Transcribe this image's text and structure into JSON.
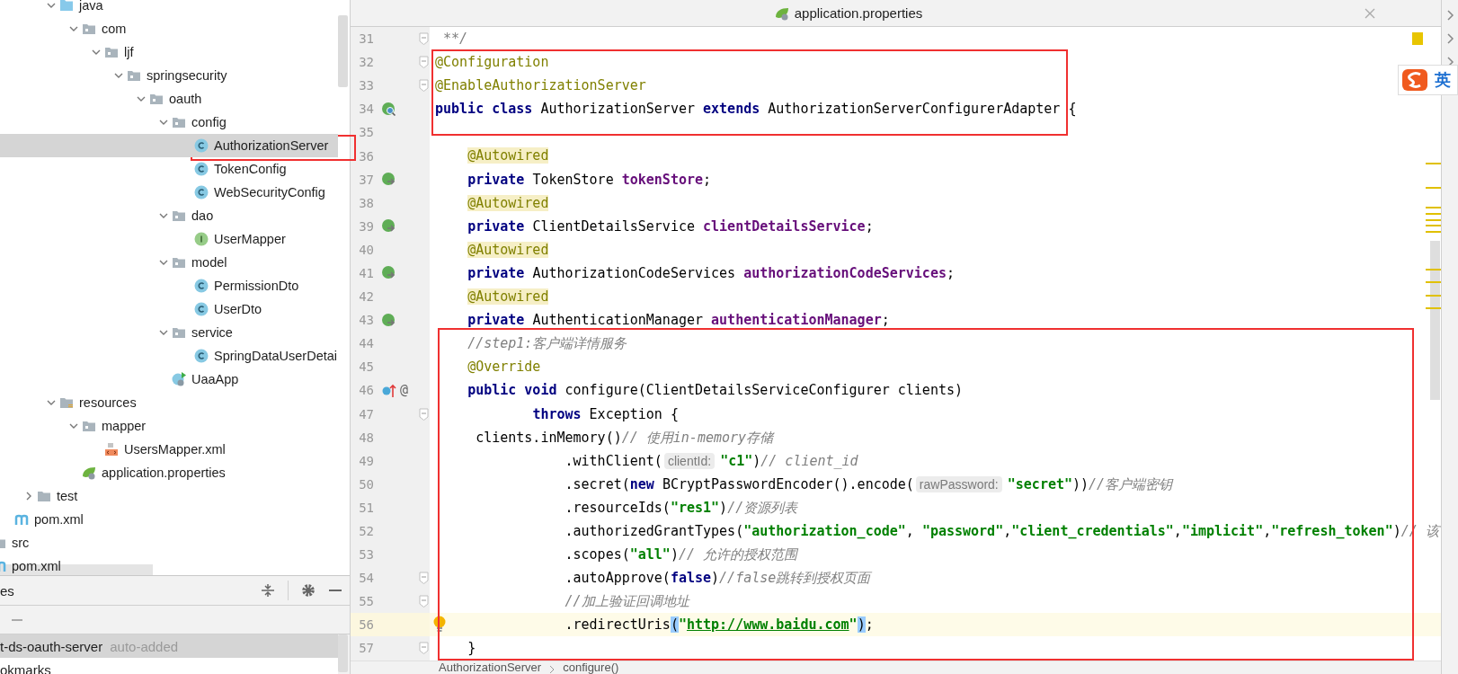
{
  "tree": [
    {
      "kind": "group",
      "children": [
        {
          "kind": "group",
          "children": [
            {
              "kind": "group",
              "children": [
                {
                  "label": "java",
                  "kind": "source-folder",
                  "expanded": true,
                  "selected": false,
                  "children": [
                    {
                      "label": "com",
                      "kind": "package",
                      "expanded": true,
                      "selected": false,
                      "children": [
                        {
                          "label": "ljf",
                          "kind": "package",
                          "expanded": true,
                          "selected": false,
                          "children": [
                            {
                              "label": "springsecurity",
                              "kind": "package",
                              "expanded": true,
                              "selected": false,
                              "children": [
                                {
                                  "label": "oauth",
                                  "kind": "package",
                                  "expanded": true,
                                  "selected": false,
                                  "children": [
                                    {
                                      "label": "config",
                                      "kind": "package",
                                      "expanded": true,
                                      "selected": false,
                                      "children": [
                                        {
                                          "label": "AuthorizationServer",
                                          "kind": "class",
                                          "selected": true
                                        },
                                        {
                                          "label": "TokenConfig",
                                          "kind": "class",
                                          "selected": false
                                        },
                                        {
                                          "label": "WebSecurityConfig",
                                          "kind": "class",
                                          "selected": false
                                        }
                                      ]
                                    },
                                    {
                                      "label": "dao",
                                      "kind": "package",
                                      "expanded": true,
                                      "selected": false,
                                      "children": [
                                        {
                                          "label": "UserMapper",
                                          "kind": "interface",
                                          "selected": false
                                        }
                                      ]
                                    },
                                    {
                                      "label": "model",
                                      "kind": "package",
                                      "expanded": true,
                                      "selected": false,
                                      "children": [
                                        {
                                          "label": "PermissionDto",
                                          "kind": "class",
                                          "selected": false
                                        },
                                        {
                                          "label": "UserDto",
                                          "kind": "class",
                                          "selected": false
                                        }
                                      ]
                                    },
                                    {
                                      "label": "service",
                                      "kind": "package",
                                      "expanded": true,
                                      "selected": false,
                                      "children": [
                                        {
                                          "label": "SpringDataUserDetai",
                                          "kind": "class",
                                          "selected": false
                                        }
                                      ]
                                    },
                                    {
                                      "label": "UaaApp",
                                      "kind": "app",
                                      "selected": false
                                    }
                                  ]
                                }
                              ]
                            }
                          ]
                        }
                      ]
                    }
                  ]
                },
                {
                  "label": "resources",
                  "kind": "resource-folder",
                  "expanded": true,
                  "selected": false,
                  "children": [
                    {
                      "label": "mapper",
                      "kind": "package",
                      "expanded": true,
                      "selected": false,
                      "children": [
                        {
                          "label": "UsersMapper.xml",
                          "kind": "xml",
                          "selected": false
                        }
                      ]
                    },
                    {
                      "label": "application.properties",
                      "kind": "properties",
                      "selected": false
                    }
                  ]
                }
              ]
            },
            {
              "label": "test",
              "kind": "folder",
              "expanded": false,
              "selected": false
            }
          ]
        },
        {
          "label": "pom.xml",
          "kind": "maven",
          "selected": false
        }
      ]
    },
    {
      "label": "src",
      "kind": "folder",
      "selected": false
    },
    {
      "label": "pom.xml",
      "kind": "maven",
      "selected": false
    }
  ],
  "bottom_panel": {
    "title": "es",
    "items": [
      {
        "label": "t-ds-oauth-server",
        "note": "auto-added",
        "selected": true
      },
      {
        "label": "okmarks",
        "selected": false
      }
    ]
  },
  "tab": {
    "label": "application.properties"
  },
  "lines": [
    {
      "number": "31",
      "fold": true,
      "current": false,
      "code": [
        {
          "kind": "comment",
          "text": " **/"
        }
      ]
    },
    {
      "number": "32",
      "fold": true,
      "current": false,
      "code": [
        {
          "kind": "annotation",
          "text": "@Configuration"
        }
      ]
    },
    {
      "number": "33",
      "fold": true,
      "current": false,
      "code": [
        {
          "kind": "annotation",
          "text": "@EnableAuthorizationServer"
        }
      ]
    },
    {
      "number": "34",
      "fold": false,
      "current": false,
      "gutter_icons": [
        {
          "kind": "bean-search"
        }
      ],
      "code": [
        {
          "kind": "keyword",
          "text": "public"
        },
        {
          "kind": "keyword",
          "text": " class"
        },
        {
          "kind": "plain",
          "text": " AuthorizationServer "
        },
        {
          "kind": "keyword",
          "text": "extends"
        },
        {
          "kind": "plain",
          "text": " AuthorizationServerConfigurerAdapter {"
        }
      ]
    },
    {
      "number": "35",
      "fold": false,
      "current": false
    },
    {
      "number": "36",
      "fold": false,
      "current": false,
      "code": [
        {
          "kind": "usage-annotation",
          "text": "    @Autowired"
        }
      ]
    },
    {
      "number": "37",
      "fold": false,
      "current": false,
      "gutter_icons": [
        {
          "kind": "bean-link"
        }
      ],
      "code": [
        {
          "kind": "keyword",
          "text": "    private"
        },
        {
          "kind": "plain",
          "text": " TokenStore "
        },
        {
          "kind": "field",
          "text": "tokenStore"
        },
        {
          "kind": "plain",
          "text": ";"
        }
      ]
    },
    {
      "number": "38",
      "fold": false,
      "current": false,
      "code": [
        {
          "kind": "usage-annotation",
          "text": "    @Autowired"
        }
      ]
    },
    {
      "number": "39",
      "fold": false,
      "current": false,
      "gutter_icons": [
        {
          "kind": "bean-link"
        }
      ],
      "code": [
        {
          "kind": "keyword",
          "text": "    private"
        },
        {
          "kind": "plain",
          "text": " ClientDetailsService "
        },
        {
          "kind": "field",
          "text": "clientDetailsService"
        },
        {
          "kind": "plain",
          "text": ";"
        }
      ]
    },
    {
      "number": "40",
      "fold": false,
      "current": false,
      "code": [
        {
          "kind": "usage-annotation",
          "text": "    @Autowired"
        }
      ]
    },
    {
      "number": "41",
      "fold": false,
      "current": false,
      "gutter_icons": [
        {
          "kind": "bean-link"
        }
      ],
      "code": [
        {
          "kind": "keyword",
          "text": "    private"
        },
        {
          "kind": "plain",
          "text": " AuthorizationCodeServices "
        },
        {
          "kind": "field",
          "text": "authorizationCodeServices"
        },
        {
          "kind": "plain",
          "text": ";"
        }
      ]
    },
    {
      "number": "42",
      "fold": false,
      "current": false,
      "code": [
        {
          "kind": "usage-annotation",
          "text": "    @Autowired"
        }
      ]
    },
    {
      "number": "43",
      "fold": false,
      "current": false,
      "gutter_icons": [
        {
          "kind": "bean-link"
        }
      ],
      "code": [
        {
          "kind": "keyword",
          "text": "    private"
        },
        {
          "kind": "plain",
          "text": " AuthenticationManager "
        },
        {
          "kind": "field",
          "text": "authenticationManager"
        },
        {
          "kind": "plain",
          "text": ";"
        }
      ]
    },
    {
      "number": "44",
      "fold": false,
      "current": false,
      "code": [
        {
          "kind": "comment",
          "text": "    //step1:客户端详情服务"
        }
      ]
    },
    {
      "number": "45",
      "fold": false,
      "current": false,
      "code": [
        {
          "kind": "annotation",
          "text": "    @Override"
        }
      ]
    },
    {
      "number": "46",
      "fold": false,
      "current": false,
      "gutter_icons": [
        {
          "kind": "override"
        }
      ],
      "gutter_text": "@",
      "code": [
        {
          "kind": "keyword",
          "text": "    public"
        },
        {
          "kind": "keyword",
          "text": " void"
        },
        {
          "kind": "plain",
          "text": " configure(ClientDetailsServiceConfigurer clients)"
        }
      ]
    },
    {
      "number": "47",
      "fold": true,
      "current": false,
      "code": [
        {
          "kind": "keyword",
          "text": "            throws"
        },
        {
          "kind": "plain",
          "text": " Exception {"
        }
      ]
    },
    {
      "number": "48",
      "fold": false,
      "current": false,
      "code": [
        {
          "kind": "plain",
          "text": "     clients.inMemory()"
        },
        {
          "kind": "comment",
          "text": "// 使用in-memory存储"
        }
      ]
    },
    {
      "number": "49",
      "fold": false,
      "current": false,
      "code": [
        {
          "kind": "plain",
          "text": "                .withClient("
        },
        {
          "kind": "hint",
          "text": "clientId:"
        },
        {
          "kind": "string",
          "text": "\"c1\""
        },
        {
          "kind": "plain",
          "text": ")"
        },
        {
          "kind": "comment",
          "text": "// client_id"
        }
      ]
    },
    {
      "number": "50",
      "fold": false,
      "current": false,
      "code": [
        {
          "kind": "plain",
          "text": "                .secret("
        },
        {
          "kind": "keyword",
          "text": "new"
        },
        {
          "kind": "plain",
          "text": " BCryptPasswordEncoder().encode("
        },
        {
          "kind": "hint",
          "text": "rawPassword:"
        },
        {
          "kind": "string",
          "text": "\"secret\""
        },
        {
          "kind": "plain",
          "text": "))"
        },
        {
          "kind": "comment",
          "text": "//客户端密钥"
        }
      ]
    },
    {
      "number": "51",
      "fold": false,
      "current": false,
      "code": [
        {
          "kind": "plain",
          "text": "                .resourceIds("
        },
        {
          "kind": "string",
          "text": "\"res1\""
        },
        {
          "kind": "plain",
          "text": ")"
        },
        {
          "kind": "comment",
          "text": "//资源列表"
        }
      ]
    },
    {
      "number": "52",
      "fold": false,
      "current": false,
      "code": [
        {
          "kind": "plain",
          "text": "                .authorizedGrantTypes("
        },
        {
          "kind": "string",
          "text": "\"authorization_code\""
        },
        {
          "kind": "plain",
          "text": ", "
        },
        {
          "kind": "string",
          "text": "\"password\""
        },
        {
          "kind": "plain",
          "text": ","
        },
        {
          "kind": "string",
          "text": "\"client_credentials\""
        },
        {
          "kind": "plain",
          "text": ","
        },
        {
          "kind": "string",
          "text": "\"implicit\""
        },
        {
          "kind": "plain",
          "text": ","
        },
        {
          "kind": "string",
          "text": "\"refresh_token\""
        },
        {
          "kind": "plain",
          "text": ")"
        },
        {
          "kind": "comment",
          "text": "// 该"
        }
      ]
    },
    {
      "number": "53",
      "fold": false,
      "current": false,
      "code": [
        {
          "kind": "plain",
          "text": "                .scopes("
        },
        {
          "kind": "string",
          "text": "\"all\""
        },
        {
          "kind": "plain",
          "text": ")"
        },
        {
          "kind": "comment",
          "text": "// 允许的授权范围"
        }
      ]
    },
    {
      "number": "54",
      "fold": true,
      "current": false,
      "code": [
        {
          "kind": "plain",
          "text": "                .autoApprove("
        },
        {
          "kind": "keyword",
          "text": "false"
        },
        {
          "kind": "plain",
          "text": ")"
        },
        {
          "kind": "comment",
          "text": "//false跳转到授权页面"
        }
      ]
    },
    {
      "number": "55",
      "fold": true,
      "current": false,
      "code": [
        {
          "kind": "comment",
          "text": "                //加上验证回调地址"
        }
      ]
    },
    {
      "number": "56",
      "fold": false,
      "current": true,
      "code": [
        {
          "kind": "plain",
          "text": "                .redirectUris"
        },
        {
          "kind": "brace-match",
          "text": "("
        },
        {
          "kind": "string",
          "text": "\""
        },
        {
          "kind": "link",
          "text": "http://www.baidu.com"
        },
        {
          "kind": "string",
          "text": "\""
        },
        {
          "kind": "brace-match",
          "text": ")"
        },
        {
          "kind": "plain",
          "text": ";"
        }
      ]
    },
    {
      "number": "57",
      "fold": true,
      "current": false,
      "code": [
        {
          "kind": "plain",
          "text": "    }"
        }
      ]
    }
  ],
  "breadcrumbs": [
    "AuthorizationServer",
    "configure()"
  ],
  "ime": {
    "label": "英"
  }
}
